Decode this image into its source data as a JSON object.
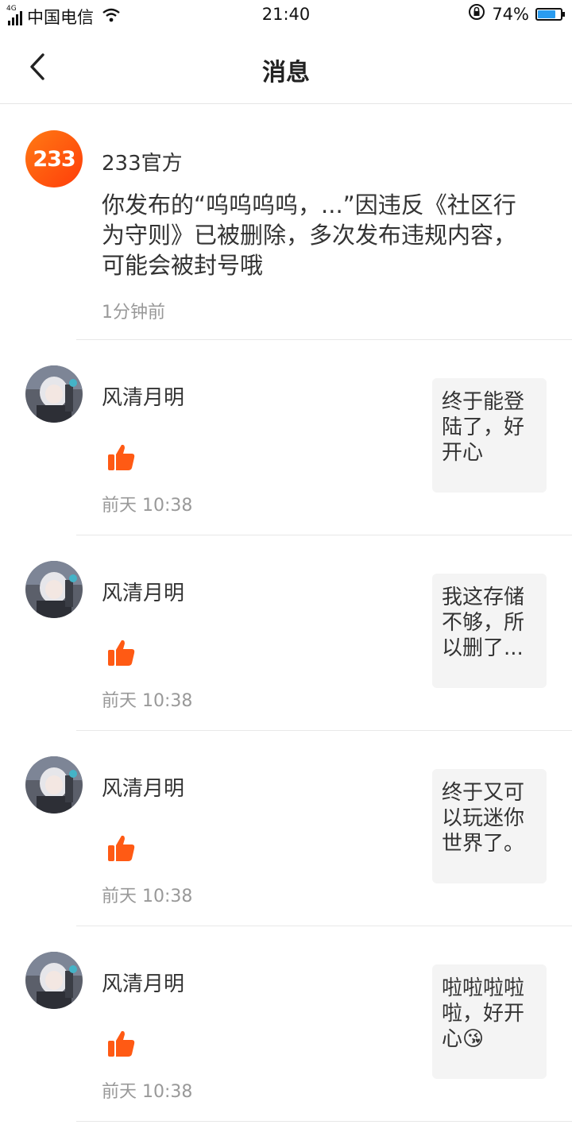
{
  "status": {
    "network": "4G",
    "carrier": "中国电信",
    "time": "21:40",
    "battery": "74%"
  },
  "nav": {
    "title": "消息"
  },
  "system_message": {
    "sender": "233官方",
    "logo_text": "233",
    "text": "你发布的“呜呜呜呜，...”因违反《社区行为守则》已被删除，多次发布违规内容，可能会被封号哦",
    "time": "1分钟前"
  },
  "messages": [
    {
      "user": "风清月明",
      "time": "前天 10:38",
      "quote": "终于能登陆了，好开心",
      "quote_emoji": ""
    },
    {
      "user": "风清月明",
      "time": "前天 10:38",
      "quote": "我这存储不够，所以删了...",
      "quote_emoji": ""
    },
    {
      "user": "风清月明",
      "time": "前天 10:38",
      "quote": "终于又可以玩迷你世界了。",
      "quote_emoji": ""
    },
    {
      "user": "风清月明",
      "time": "前天 10:38",
      "quote": "啦啦啦啦啦，好开心",
      "quote_emoji": "😘"
    }
  ],
  "colors": {
    "accent": "#ff5a14",
    "divider": "#e8e8e8",
    "quote_bg": "#f4f4f4",
    "secondary_text": "#999999"
  }
}
